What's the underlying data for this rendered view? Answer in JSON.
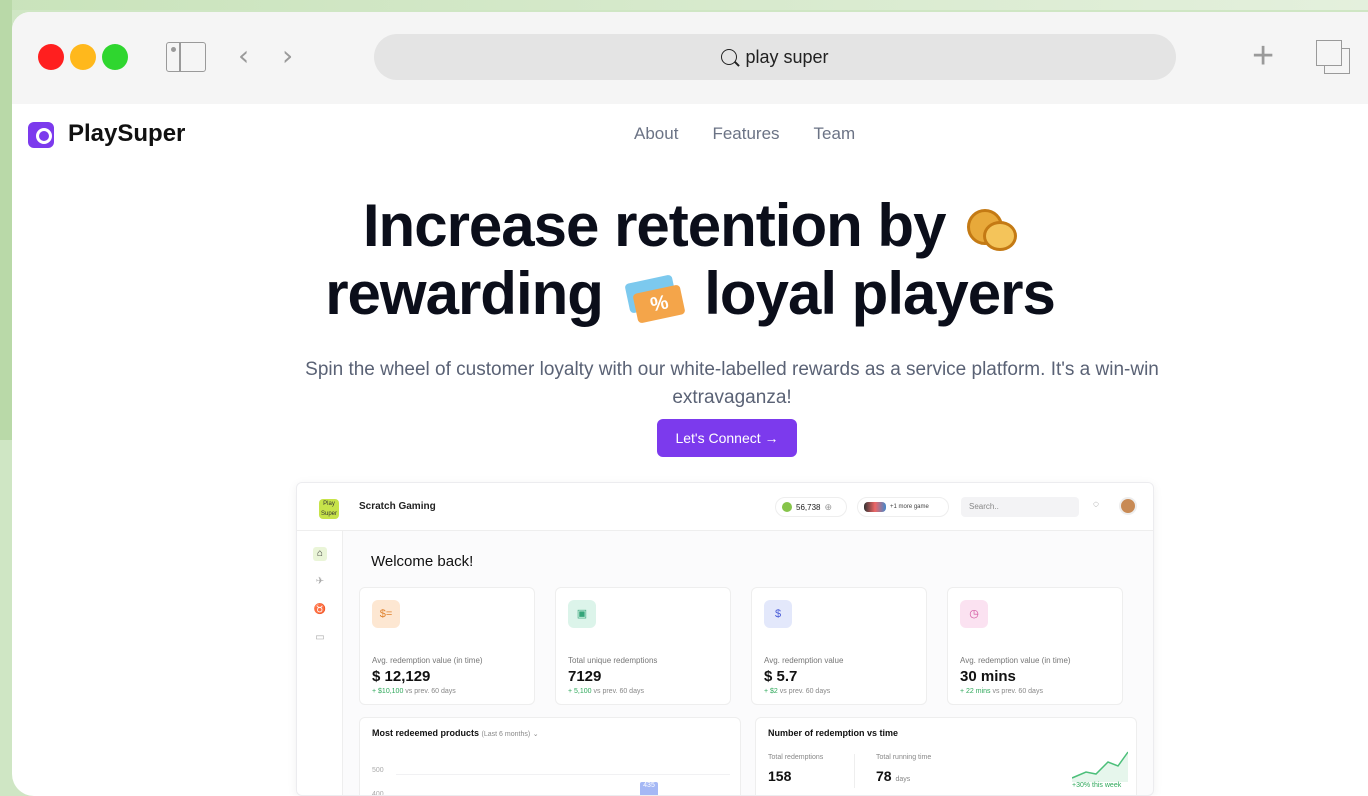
{
  "browser": {
    "address": "play super"
  },
  "site": {
    "brand": "PlaySuper",
    "nav": [
      "About",
      "Features",
      "Team"
    ],
    "hero_line1": "Increase retention by",
    "hero_line2a": "rewarding",
    "hero_line2b": "loyal players",
    "ticket_glyph": "%",
    "subtitle": "Spin the wheel of customer loyalty with our white-labelled rewards as a service platform. It's a win-win extravaganza!",
    "cta": "Let's Connect →"
  },
  "dashboard": {
    "logo_text": "Play Super",
    "workspace": "Scratch Gaming",
    "coins": "56,738",
    "coins_add": "⊕",
    "more_games": "+1 more game",
    "search_placeholder": "Search..",
    "welcome": "Welcome back!",
    "cards": [
      {
        "label": "Avg. redemption value (in time)",
        "value": "$ 12,129",
        "delta_strong": "+ $10,100",
        "delta_rest": " vs prev. 60 days",
        "icon": "cash-icon",
        "icon_glyph": "$=",
        "icon_color": "#fde7d2",
        "icon_ink": "#e0832f"
      },
      {
        "label": "Total unique redemptions",
        "value": "7129",
        "delta_strong": "+ 5,100",
        "delta_rest": " vs prev. 60 days",
        "icon": "gift-icon",
        "icon_glyph": "▣",
        "icon_color": "#dcf4ea",
        "icon_ink": "#36a57a"
      },
      {
        "label": "Avg. redemption value",
        "value": "$ 5.7",
        "delta_strong": "+ $2",
        "delta_rest": " vs prev. 60 days",
        "icon": "dollar-coin-icon",
        "icon_glyph": "$",
        "icon_color": "#e3e8fb",
        "icon_ink": "#4a5dd8"
      },
      {
        "label": "Avg. redemption value (in time)",
        "value": "30 mins",
        "delta_strong": "+ 22 mins",
        "delta_rest": " vs prev. 60 days",
        "icon": "timer-icon",
        "icon_glyph": "◷",
        "icon_color": "#fbe2f1",
        "icon_ink": "#d04a9a"
      }
    ],
    "products_title": "Most redeemed products",
    "products_range": "(Last 6 months)",
    "axis_500": "500",
    "axis_400": "400",
    "bar_value": "435",
    "redemption_title": "Number of redemption vs time",
    "total_redemptions_label": "Total redemptions",
    "total_redemptions_value": "158",
    "running_time_label": "Total running time",
    "running_time_value": "78",
    "running_time_unit": "days",
    "week_delta": "+30% this week"
  },
  "colors": {
    "brand": "#7c3aed",
    "backdrop": "#cfe6c4"
  }
}
